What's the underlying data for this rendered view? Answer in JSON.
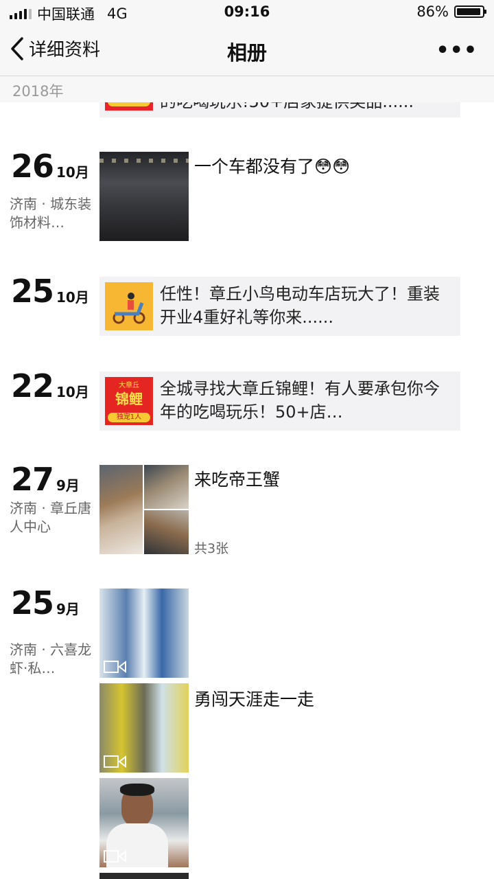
{
  "status": {
    "carrier": "中国联通",
    "network": "4G",
    "time": "09:16",
    "battery": "86%"
  },
  "nav": {
    "back_label": "详细资料",
    "title": "相册",
    "more": "•••"
  },
  "year": "2018年",
  "top_card": {
    "text": "的吃喝玩乐!50+店家提供奖品......"
  },
  "entries": [
    {
      "day": "26",
      "month": "10月",
      "location": "济南 · 城东装饰材料…",
      "caption": "一个车都没有了😳😳"
    },
    {
      "day": "25",
      "month": "10月",
      "card_text": "任性！章丘小鸟电动车店玩大了！重装开业4重好礼等你来......"
    },
    {
      "day": "22",
      "month": "10月",
      "card_text": "全城寻找大章丘锦鲤！有人要承包你今年的吃喝玩乐！50+店…",
      "thumb_top": "大章丘",
      "thumb_main": "锦鲤",
      "thumb_badge": "独宠1人"
    },
    {
      "day": "27",
      "month": "9月",
      "location": "济南 · 章丘唐人中心",
      "caption": "来吃帝王蟹",
      "count": "共3张"
    },
    {
      "day": "25",
      "month": "9月",
      "location": "济南 · 六喜龙虾·私…",
      "caption": "勇闯天涯走一走"
    }
  ],
  "colors": {
    "card_bg": "#f2f2f4",
    "bar_bg": "#f7f7f7",
    "year_text": "#999999"
  }
}
